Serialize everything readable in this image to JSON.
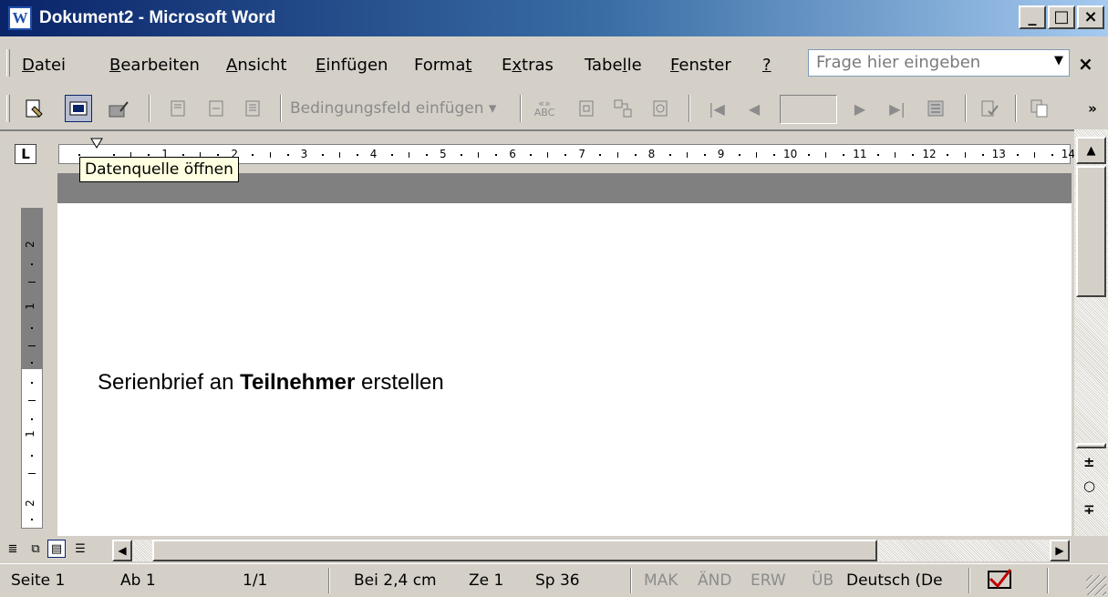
{
  "window": {
    "title": "Dokument2 - Microsoft Word",
    "app_icon_letter": "W",
    "minimize": "_",
    "maximize": "□",
    "close": "×"
  },
  "menu": {
    "items": [
      {
        "pre": "",
        "u": "D",
        "post": "atei"
      },
      {
        "pre": "",
        "u": "B",
        "post": "earbeiten"
      },
      {
        "pre": "",
        "u": "A",
        "post": "nsicht"
      },
      {
        "pre": "",
        "u": "E",
        "post": "infügen"
      },
      {
        "pre": "Forma",
        "u": "t",
        "post": ""
      },
      {
        "pre": "E",
        "u": "x",
        "post": "tras"
      },
      {
        "pre": "Tabe",
        "u": "l",
        "post": "le"
      },
      {
        "pre": "",
        "u": "F",
        "post": "enster"
      },
      {
        "pre": "",
        "u": "?",
        "post": ""
      }
    ],
    "ask_placeholder": "Frage hier eingeben",
    "close_doc": "×"
  },
  "toolbar": {
    "conditional_field": "Bedingungsfeld einfügen ▾",
    "overflow": "»"
  },
  "ruler": {
    "labels": [
      "1",
      "2",
      "3",
      "4",
      "5",
      "6",
      "7",
      "8",
      "9",
      "10",
      "11",
      "12",
      "13",
      "14"
    ],
    "tab_selector": "L"
  },
  "tooltip": "Datenquelle öffnen",
  "document": {
    "text_before": "Serienbrief an ",
    "text_bold": "Teilnehmer",
    "text_after": " erstellen"
  },
  "vruler": {
    "labels": [
      "2",
      "1",
      "1",
      "2"
    ]
  },
  "statusbar": {
    "page": "Seite 1",
    "section": "Ab 1",
    "pages": "1/1",
    "at": "Bei 2,4 cm",
    "line": "Ze 1",
    "col": "Sp 36",
    "rec": "MAK",
    "trk": "ÄND",
    "ext": "ERW",
    "ovr": "ÜB",
    "language": "Deutsch (De"
  }
}
